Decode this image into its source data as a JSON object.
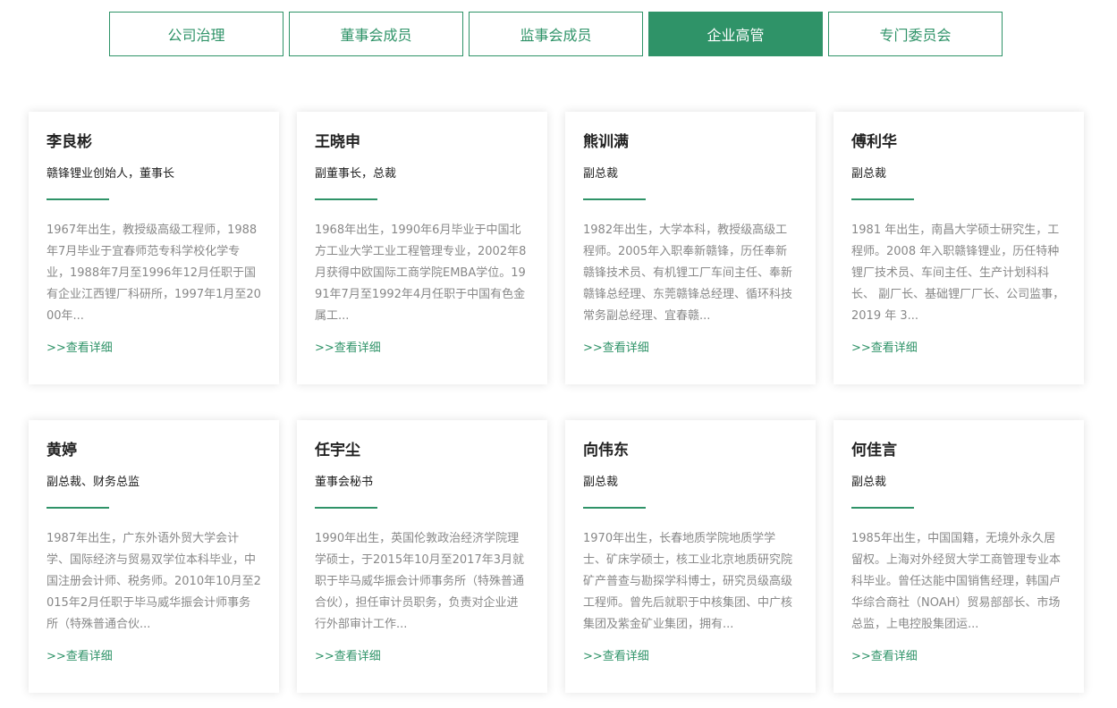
{
  "tabs": [
    {
      "label": "公司治理",
      "active": false
    },
    {
      "label": "董事会成员",
      "active": false
    },
    {
      "label": "监事会成员",
      "active": false
    },
    {
      "label": "企业高管",
      "active": true
    },
    {
      "label": "专门委员会",
      "active": false
    }
  ],
  "accent_color": "#2f9368",
  "more_label": ">>查看详细",
  "executives": [
    {
      "name": "李良彬",
      "title": "赣锋锂业创始人，董事长",
      "bio": "1967年出生，教授级高级工程师，1988年7月毕业于宜春师范专科学校化学专业，1988年7月至1996年12月任职于国有企业江西锂厂科研所，1997年1月至2000年..."
    },
    {
      "name": "王晓申",
      "title": "副董事长，总裁",
      "bio": "1968年出生，1990年6月毕业于中国北方工业大学工业工程管理专业，2002年8月获得中欧国际工商学院EMBA学位。1991年7月至1992年4月任职于中国有色金属工..."
    },
    {
      "name": "熊训满",
      "title": "副总裁",
      "bio": "1982年出生，大学本科，教授级高级工程师。2005年入职奉新赣锋，历任奉新赣锋技术员、有机锂工厂车间主任、奉新赣锋总经理、东莞赣锋总经理、循环科技常务副总经理、宜春赣..."
    },
    {
      "name": "傅利华",
      "title": "副总裁",
      "bio": "1981 年出生，南昌大学硕士研究生，工程师。2008 年入职赣锋锂业，历任特种锂厂技术员、车间主任、生产计划科科长、 副厂长、基础锂厂厂长、公司监事，2019 年 3..."
    },
    {
      "name": "黄婷",
      "title": "副总裁、财务总监",
      "bio": "1987年出生，广东外语外贸大学会计学、国际经济与贸易双学位本科毕业，中国注册会计师、税务师。2010年10月至2015年2月任职于毕马威华振会计师事务所（特殊普通合伙..."
    },
    {
      "name": "任宇尘",
      "title": "董事会秘书",
      "bio": "1990年出生，英国伦敦政治经济学院理学硕士，于2015年10月至2017年3月就职于毕马威华振会计师事务所（特殊普通合伙），担任审计员职务，负责对企业进行外部审计工作..."
    },
    {
      "name": "向伟东",
      "title": "副总裁",
      "bio": "1970年出生，长春地质学院地质学学士、矿床学硕士，核工业北京地质研究院矿产普查与勘探学科博士，研究员级高级工程师。曾先后就职于中核集团、中广核集团及紫金矿业集团，拥有..."
    },
    {
      "name": "何佳言",
      "title": "副总裁",
      "bio": "1985年出生，中国国籍，无境外永久居留权。上海对外经贸大学工商管理专业本科毕业。曾任达能中国销售经理，韩国卢华综合商社（NOAH）贸易部部长、市场总监，上电控股集团运..."
    }
  ]
}
